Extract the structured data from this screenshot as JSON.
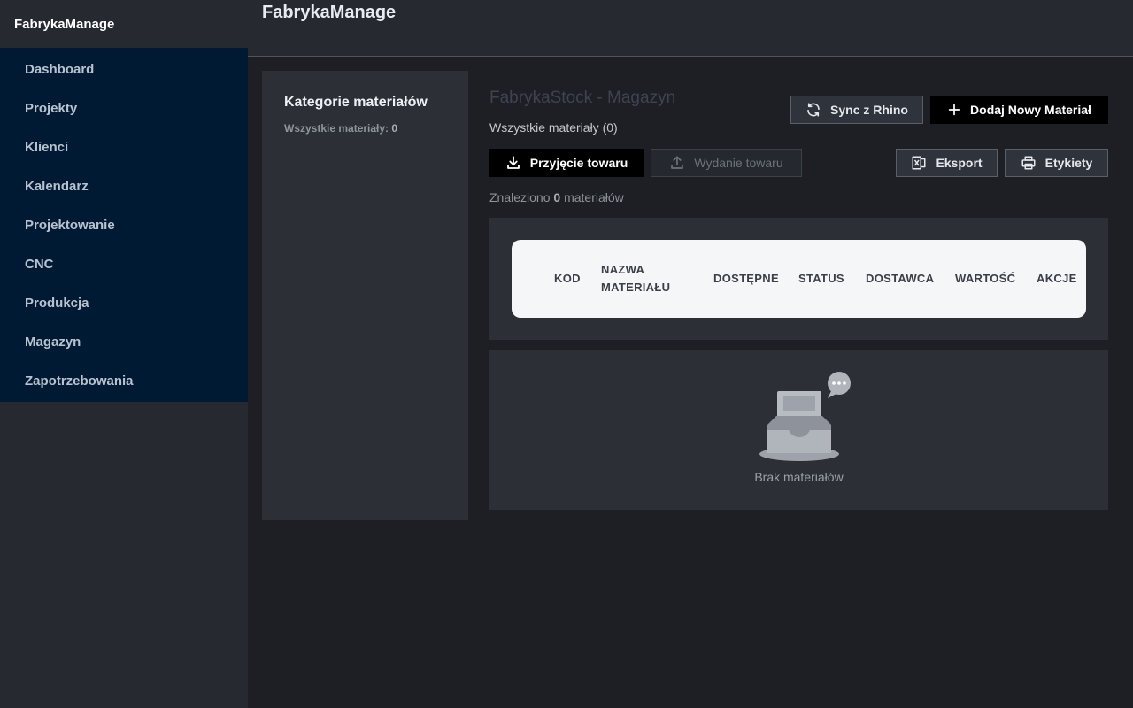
{
  "app": {
    "brand": "FabrykaManage",
    "header_title": "FabrykaManage"
  },
  "sidebar": {
    "items": [
      {
        "label": "Dashboard"
      },
      {
        "label": "Projekty"
      },
      {
        "label": "Klienci"
      },
      {
        "label": "Kalendarz"
      },
      {
        "label": "Projektowanie"
      },
      {
        "label": "CNC"
      },
      {
        "label": "Produkcja"
      },
      {
        "label": "Magazyn"
      },
      {
        "label": "Zapotrzebowania"
      }
    ]
  },
  "categories": {
    "title": "Kategorie materiałów",
    "all_label": "Wszystkie materiały:",
    "all_count": "0"
  },
  "main": {
    "title": "FabrykaStock - Magazyn",
    "subtitle": "Wszystkie materiały (0)",
    "found_prefix": "Znaleziono",
    "found_count": "0",
    "found_suffix": "materiałów"
  },
  "buttons": {
    "sync": {
      "label": "Sync z Rhino",
      "icon": "sync-icon"
    },
    "add": {
      "label": "Dodaj Nowy Materiał",
      "icon": "plus-icon"
    },
    "receive": {
      "label": "Przyjęcie towaru",
      "icon": "download-icon"
    },
    "issue": {
      "label": "Wydanie towaru",
      "icon": "upload-icon"
    },
    "export": {
      "label": "Eksport",
      "icon": "excel-icon"
    },
    "labels": {
      "label": "Etykiety",
      "icon": "printer-icon"
    }
  },
  "table": {
    "columns": {
      "code": "KOD",
      "name_line1": "NAZWA",
      "name_line2": "MATERIAŁU",
      "available": "DOSTĘPNE",
      "status": "STATUS",
      "supplier": "DOSTAWCA",
      "value": "WARTOŚĆ",
      "actions": "AKCJE"
    },
    "rows": []
  },
  "empty_state": {
    "text": "Brak materiałów",
    "icon": "empty-inbox-icon"
  },
  "colors": {
    "sidebar_nav_bg": "#001a33",
    "panel_bg": "#2c2f36",
    "page_bg": "#1d1f24",
    "primary_button_bg": "#000000"
  }
}
